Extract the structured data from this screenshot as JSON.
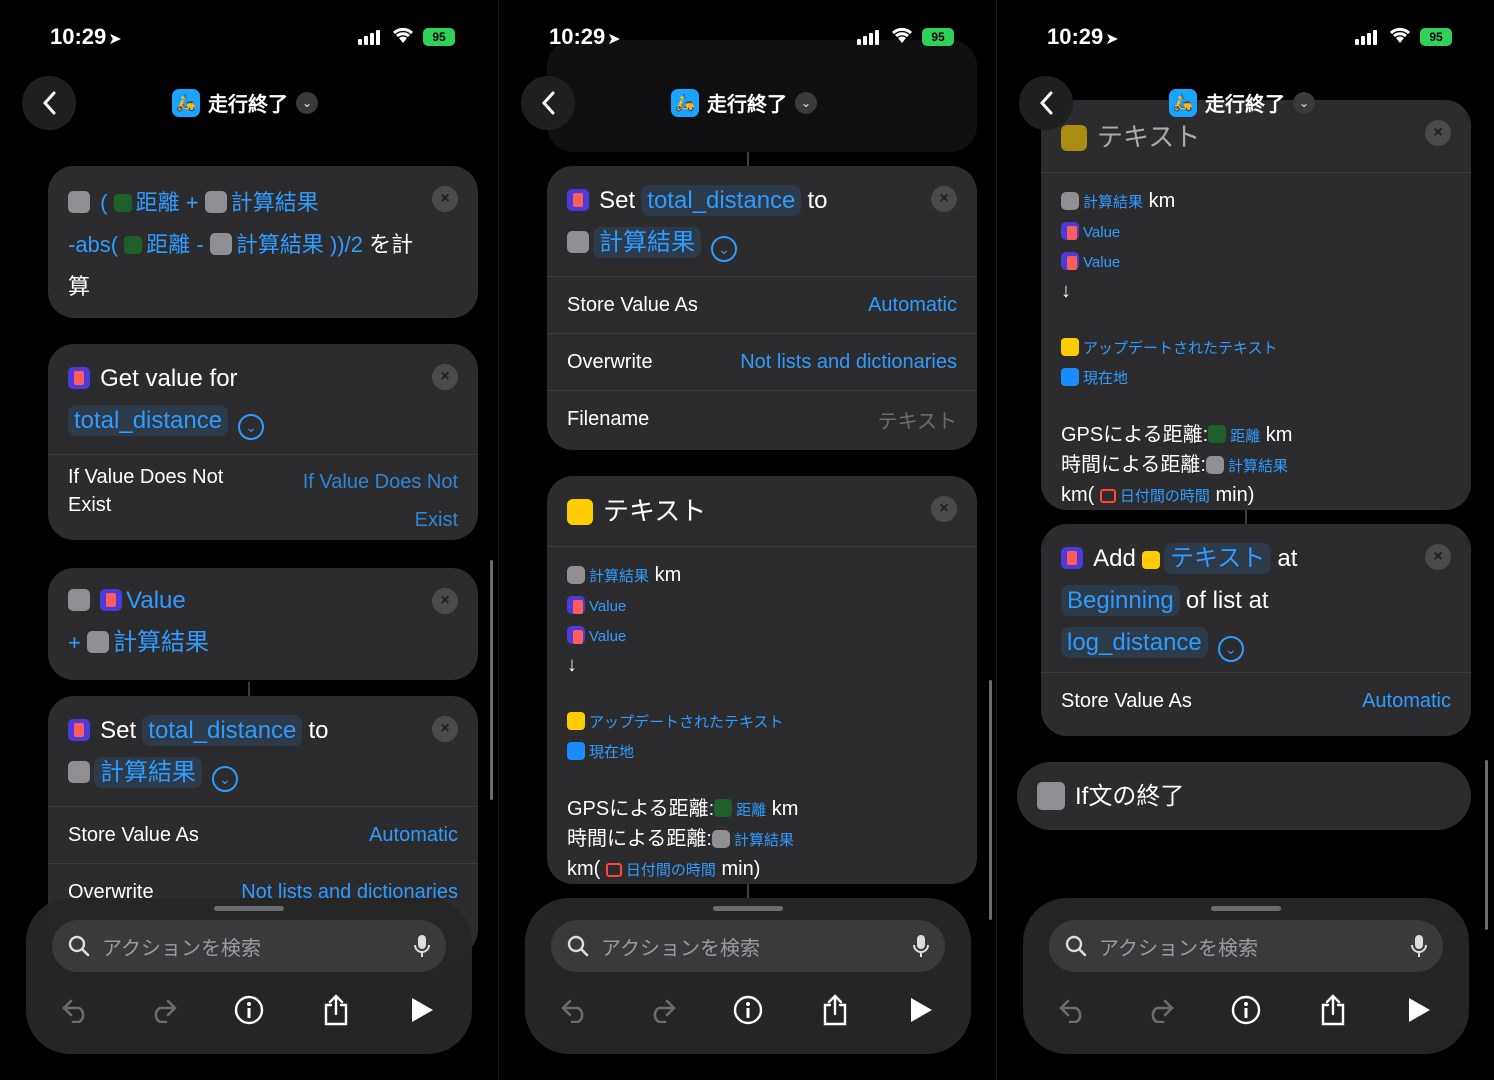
{
  "status": {
    "time": "10:29",
    "battery": "95"
  },
  "nav": {
    "title": "走行終了"
  },
  "search": {
    "placeholder": "アクションを検索"
  },
  "panel1": {
    "calc": {
      "open_paren": "(",
      "kyori": "距離",
      "plus": "+",
      "keisan": "計算結果",
      "abs": "-abs(",
      "kyori2": "距離",
      "minus": "-",
      "keisan2": "計算結果",
      "tail": "))/2",
      "suffix": "を計",
      "suffix2": "算"
    },
    "get": {
      "label": "Get value for",
      "key": "total_distance",
      "if_label": "If Value Does Not Exist",
      "if_value": "If Value Does Not Exist"
    },
    "add": {
      "value": "Value",
      "plus": "+",
      "keisan": "計算結果"
    },
    "set": {
      "label": "Set",
      "key": "total_distance",
      "to": "to",
      "value": "計算結果",
      "store_label": "Store Value As",
      "store_value": "Automatic",
      "overwrite_label": "Overwrite",
      "overwrite_value": "Not lists and dictionaries"
    }
  },
  "panel2": {
    "set": {
      "label": "Set",
      "key": "total_distance",
      "to": "to",
      "value": "計算結果",
      "store_label": "Store Value As",
      "store_value": "Automatic",
      "overwrite_label": "Overwrite",
      "overwrite_value": "Not lists and dictionaries",
      "filename_label": "Filename",
      "filename_value": "テキスト"
    },
    "text": {
      "title": "テキスト",
      "l1_tok": "計算結果",
      "l1_txt": "km",
      "l2": "Value",
      "l3": "Value",
      "arrow": "↓",
      "l5": "アップデートされたテキスト",
      "l6": "現在地",
      "gps_label": "GPSによる距離:",
      "gps_tok": "距離",
      "gps_unit": "km",
      "time_label": "時間による距離:",
      "time_tok": "計算結果",
      "km_open": "km(",
      "date_tok": "日付間の時間",
      "min_close": "min)"
    }
  },
  "panel3": {
    "text": {
      "title": "テキスト",
      "l1_tok": "計算結果",
      "l1_txt": "km",
      "l2": "Value",
      "l3": "Value",
      "arrow": "↓",
      "l5": "アップデートされたテキスト",
      "l6": "現在地",
      "gps_label": "GPSによる距離:",
      "gps_tok": "距離",
      "gps_unit": "km",
      "time_label": "時間による距離:",
      "time_tok": "計算結果",
      "km_open": "km(",
      "date_tok": "日付間の時間",
      "min_close": "min)"
    },
    "add": {
      "label": "Add",
      "item": "テキスト",
      "at": "at",
      "position": "Beginning",
      "list_label": "of list at",
      "list": "log_distance",
      "store_label": "Store Value As",
      "store_value": "Automatic"
    },
    "endif": {
      "label": "If文の終了"
    }
  },
  "colors": {
    "accent": "#2f9bff",
    "card": "#2c2c2e",
    "background": "#000000",
    "battery": "#30d158"
  }
}
